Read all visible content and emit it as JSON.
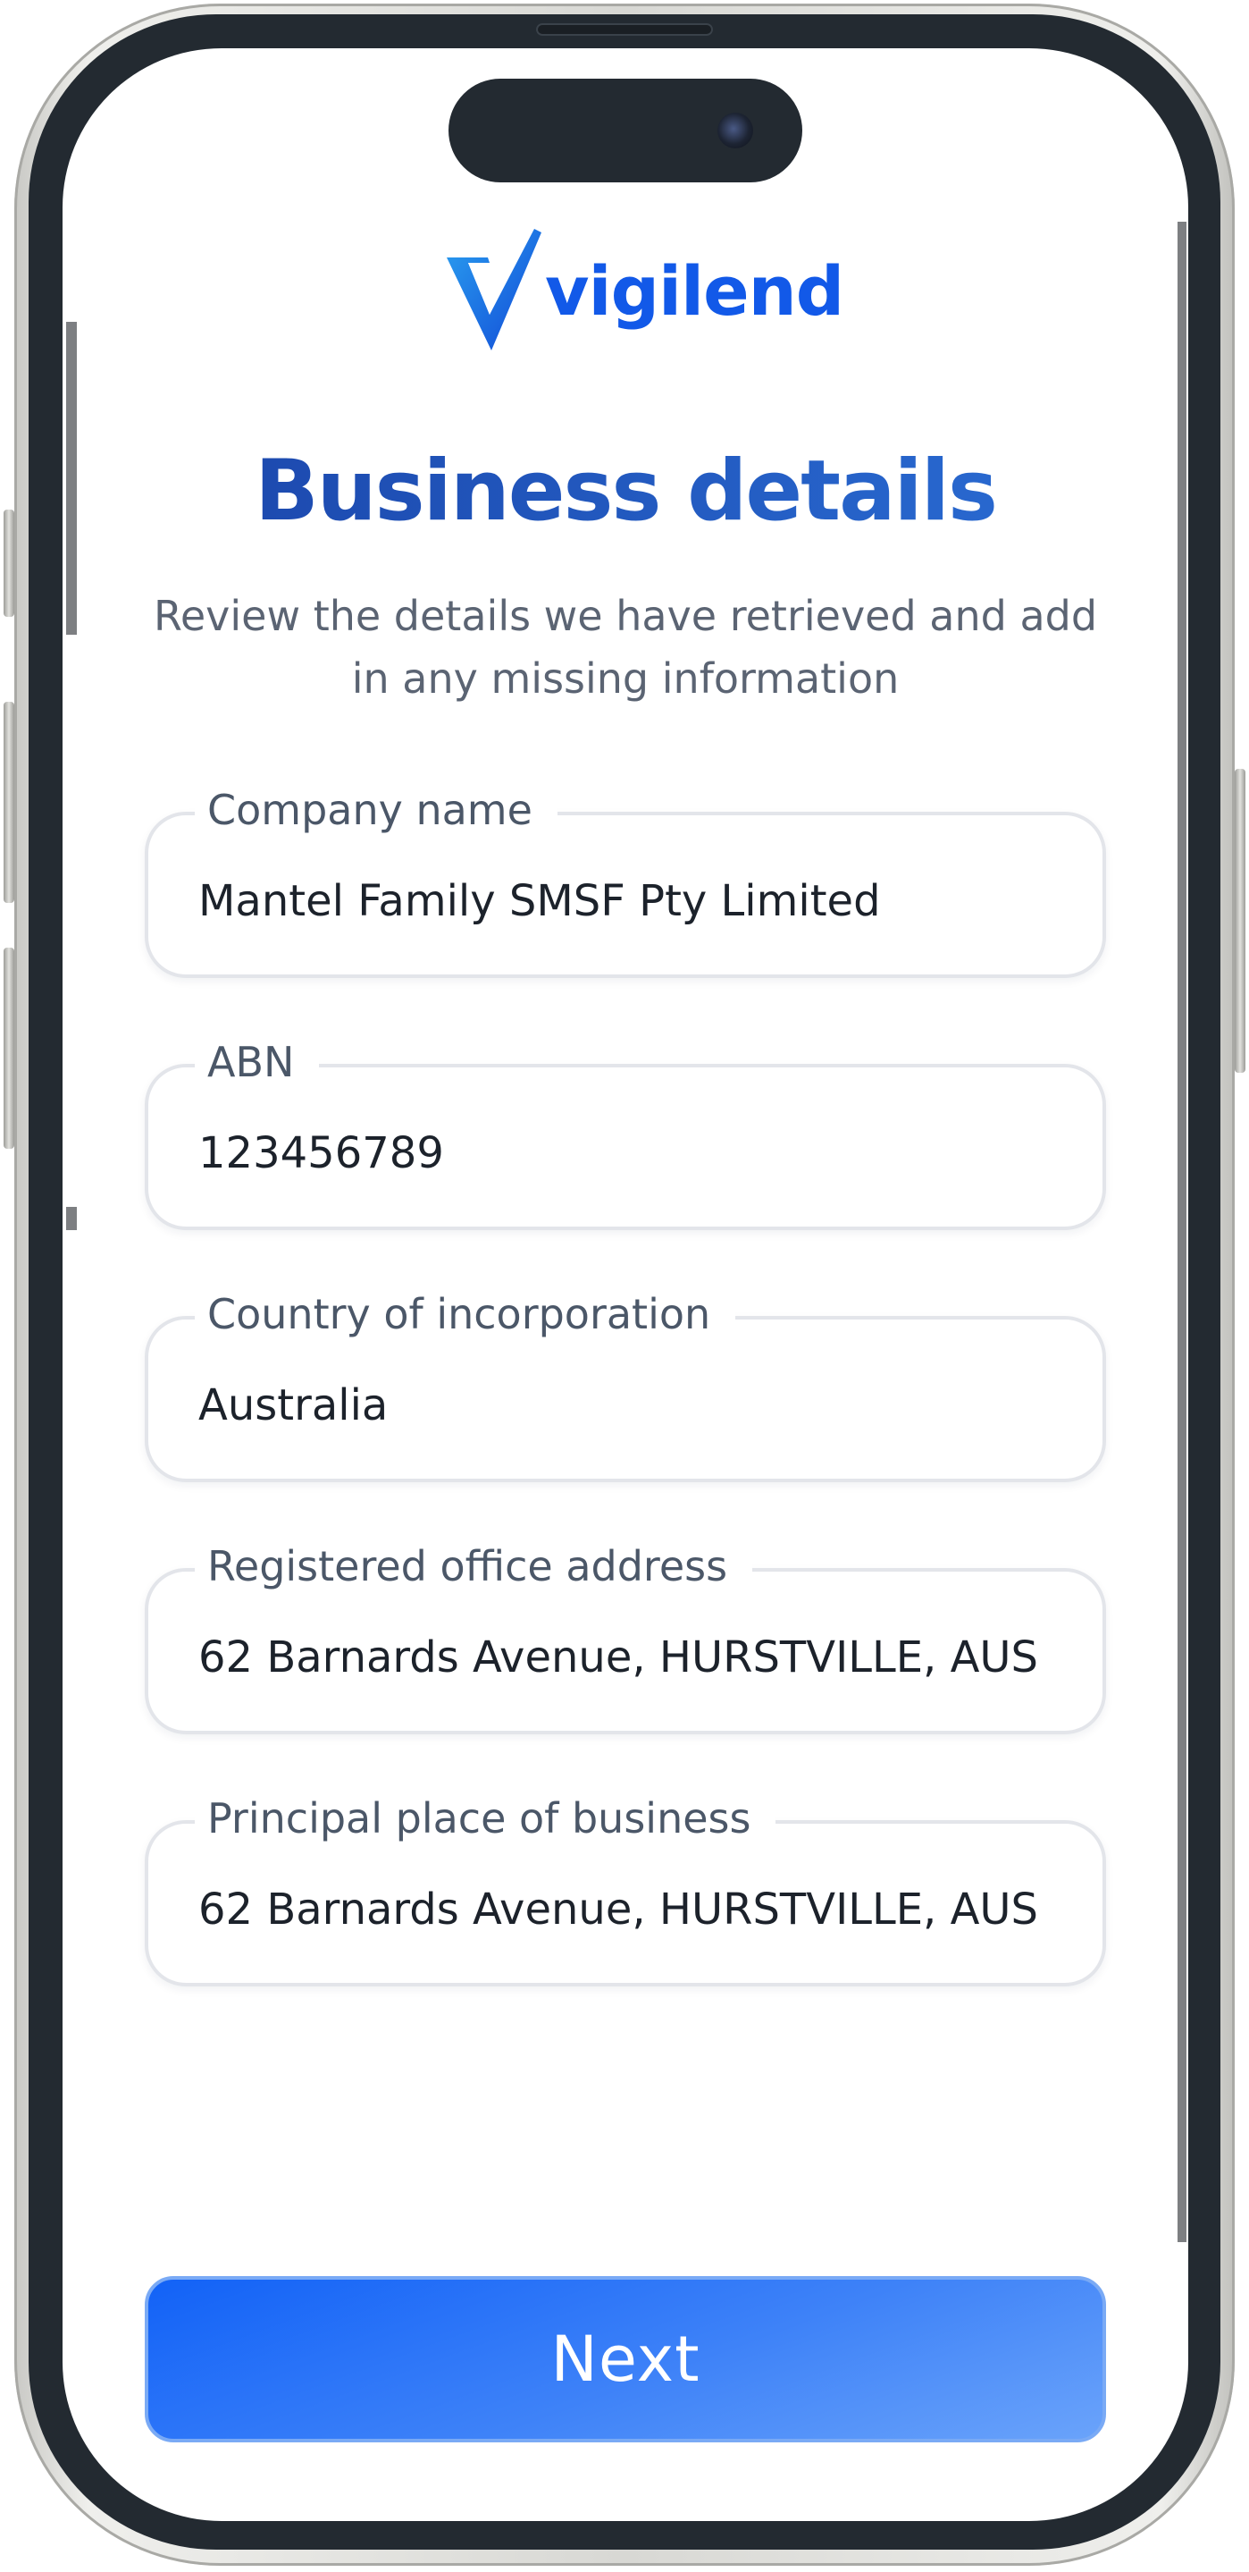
{
  "brand": {
    "name": "vigilend",
    "logo_icon": "v-check-logo-icon",
    "colors": {
      "primary": "#1259e8",
      "title_start": "#1a43a8",
      "title_end": "#2b6fd6"
    }
  },
  "page": {
    "title": "Business details",
    "subtitle_line1": "Review the details we have retrieved and add",
    "subtitle_line2": "in any missing information"
  },
  "fields": [
    {
      "label": "Company name",
      "value": "Mantel Family SMSF Pty Limited"
    },
    {
      "label": "ABN",
      "value": "123456789"
    },
    {
      "label": "Country of incorporation",
      "value": "Australia"
    },
    {
      "label": "Registered office address",
      "value": "62 Barnards Avenue, HURSTVILLE, AUS"
    },
    {
      "label": "Principal place of business",
      "value": "62 Barnards Avenue, HURSTVILLE, AUS"
    }
  ],
  "actions": {
    "next_label": "Next",
    "next_colors": {
      "start": "#1262f7",
      "end": "#6aa3fa"
    }
  }
}
